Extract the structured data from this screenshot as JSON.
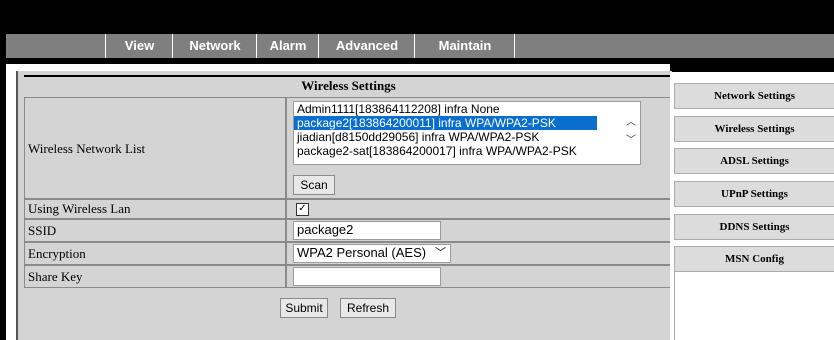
{
  "nav": {
    "items": [
      "View",
      "Network",
      "Alarm",
      "Advanced",
      "Maintain"
    ]
  },
  "panel": {
    "title": "Wireless Settings",
    "network_list_label": "Wireless Network List",
    "networks": [
      "Admin1111[183864112208] infra None",
      "package2[183864200011] infra WPA/WPA2-PSK",
      "jiadian[d8150dd29056] infra WPA/WPA2-PSK",
      "package2-sat[183864200017] infra WPA/WPA2-PSK"
    ],
    "selected_network_index": 1,
    "scan_label": "Scan",
    "using_wlan_label": "Using Wireless Lan",
    "using_wlan_checked": "✓",
    "ssid_label": "SSID",
    "ssid_value": "package2",
    "encryption_label": "Encryption",
    "encryption_value": "WPA2 Personal (AES)",
    "share_key_label": "Share Key",
    "share_key_value": "",
    "submit_label": "Submit",
    "refresh_label": "Refresh"
  },
  "sidebar": {
    "items": [
      "Network Settings",
      "Wireless Settings",
      "ADSL Settings",
      "UPnP Settings",
      "DDNS Settings",
      "MSN Config"
    ]
  },
  "colors": {
    "selection": "#0a6ed1",
    "nav_bg": "#7f7f7f",
    "panel_bg": "#d4d4d4"
  }
}
